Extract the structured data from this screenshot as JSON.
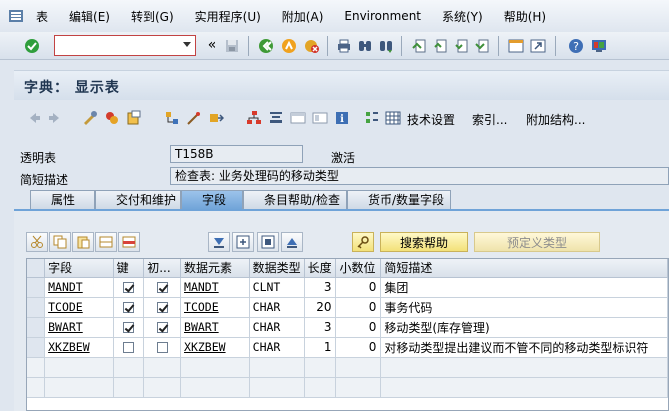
{
  "menu": {
    "items": [
      "表",
      "编辑(E)",
      "转到(G)",
      "实用程序(U)",
      "附加(A)",
      "Environment",
      "系统(Y)",
      "帮助(H)"
    ]
  },
  "toolbar": {
    "command_value": "",
    "double_arrow": "«"
  },
  "screen": {
    "title": "字典： 显示表"
  },
  "appbar": {
    "tech_settings": "技术设置",
    "index": "索引...",
    "append_structure": "附加结构..."
  },
  "header": {
    "transparent_table_label": "透明表",
    "transparent_table_value": "T158B",
    "status": "激活",
    "short_desc_label": "简短描述",
    "short_desc_value": "检查表: 业务处理码的移动类型"
  },
  "tabs": [
    {
      "label": "属性"
    },
    {
      "label": "交付和维护"
    },
    {
      "label": "字段"
    },
    {
      "label": "条目帮助/检查"
    },
    {
      "label": "货币/数量字段"
    }
  ],
  "fields_toolbar": {
    "search_help": "搜索帮助",
    "predefined_type": "预定义类型"
  },
  "grid": {
    "columns": [
      "字段",
      "键",
      "初...",
      "数据元素",
      "数据类型",
      "长度",
      "小数位",
      "简短描述"
    ],
    "rows": [
      {
        "field": "MANDT",
        "key": true,
        "init": true,
        "element": "MANDT",
        "type": "CLNT",
        "length": "3",
        "decimals": "0",
        "desc": "集团"
      },
      {
        "field": "TCODE",
        "key": true,
        "init": true,
        "element": "TCODE",
        "type": "CHAR",
        "length": "20",
        "decimals": "0",
        "desc": "事务代码"
      },
      {
        "field": "BWART",
        "key": true,
        "init": true,
        "element": "BWART",
        "type": "CHAR",
        "length": "3",
        "decimals": "0",
        "desc": "移动类型(库存管理)"
      },
      {
        "field": "XKZBEW",
        "key": false,
        "init": false,
        "element": "XKZBEW",
        "type": "CHAR",
        "length": "1",
        "decimals": "0",
        "desc": "对移动类型提出建议而不管不同的移动类型标识符"
      }
    ]
  }
}
